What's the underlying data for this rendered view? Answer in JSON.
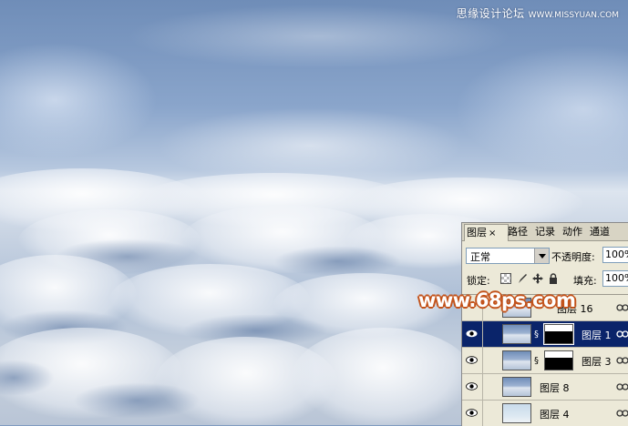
{
  "watermark": {
    "site_cn": "思缘设计论坛",
    "site_url": "WWW.MISSYUAN.COM",
    "logo_text": "www.68ps.com"
  },
  "layers_panel": {
    "tabs": [
      {
        "label": "图层",
        "close": "×",
        "active": true
      },
      {
        "label": "路径",
        "active": false
      },
      {
        "label": "记录",
        "active": false
      },
      {
        "label": "动作",
        "active": false
      },
      {
        "label": "通道",
        "active": false
      }
    ],
    "blend_mode": "正常",
    "opacity_label": "不透明度:",
    "opacity_value": "100%",
    "lock_label": "锁定:",
    "fill_label": "填充:",
    "fill_value": "100%",
    "layers": [
      {
        "name": "图层 16",
        "visible": false,
        "selected": false,
        "has_mask": false
      },
      {
        "name": "图层 1",
        "visible": true,
        "selected": true,
        "has_mask": true
      },
      {
        "name": "图层 3",
        "visible": true,
        "selected": false,
        "has_mask": true
      },
      {
        "name": "图层 8",
        "visible": true,
        "selected": false,
        "has_mask": false
      },
      {
        "name": "图层 4",
        "visible": true,
        "selected": false,
        "has_mask": false
      }
    ]
  },
  "colors": {
    "selection": "#0a246a",
    "panel_bg": "#ece9d8",
    "logo_outline": "#c2521a"
  }
}
